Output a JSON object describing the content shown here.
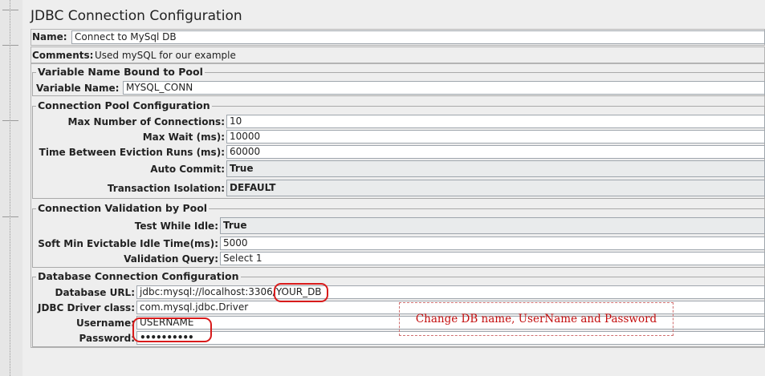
{
  "title": "JDBC Connection Configuration",
  "name": {
    "label": "Name:",
    "value": "Connect to MySql DB"
  },
  "comments": {
    "label": "Comments:",
    "value": "Used mySQL for our example"
  },
  "variable_group": {
    "title": "Variable Name Bound to Pool",
    "label": "Variable Name:",
    "value": "MYSQL_CONN"
  },
  "pool_group": {
    "title": "Connection Pool Configuration",
    "max_connections": {
      "label": "Max Number of Connections:",
      "value": "10"
    },
    "max_wait": {
      "label": "Max Wait (ms):",
      "value": "10000"
    },
    "eviction": {
      "label": "Time Between Eviction Runs (ms):",
      "value": "60000"
    },
    "auto_commit": {
      "label": "Auto Commit:",
      "value": "True"
    },
    "isolation": {
      "label": "Transaction Isolation:",
      "value": "DEFAULT"
    }
  },
  "validation_group": {
    "title": "Connection Validation by Pool",
    "test_idle": {
      "label": "Test While Idle:",
      "value": "True"
    },
    "soft_min": {
      "label": "Soft Min Evictable Idle Time(ms):",
      "value": "5000"
    },
    "query": {
      "label": "Validation Query:",
      "value": "Select 1"
    }
  },
  "db_group": {
    "title": "Database Connection Configuration",
    "url": {
      "label": "Database URL:",
      "value": "jdbc:mysql://localhost:3306/",
      "highlight": "YOUR_DB"
    },
    "driver": {
      "label": "JDBC Driver class:",
      "value": "com.mysql.jdbc.Driver"
    },
    "username": {
      "label": "Username:",
      "value": "USERNAME"
    },
    "password": {
      "label": "Password:",
      "value": "••••••••••"
    }
  },
  "annotation": {
    "text": "Change DB name, UserName and Password",
    "color": "#c40d0d"
  }
}
